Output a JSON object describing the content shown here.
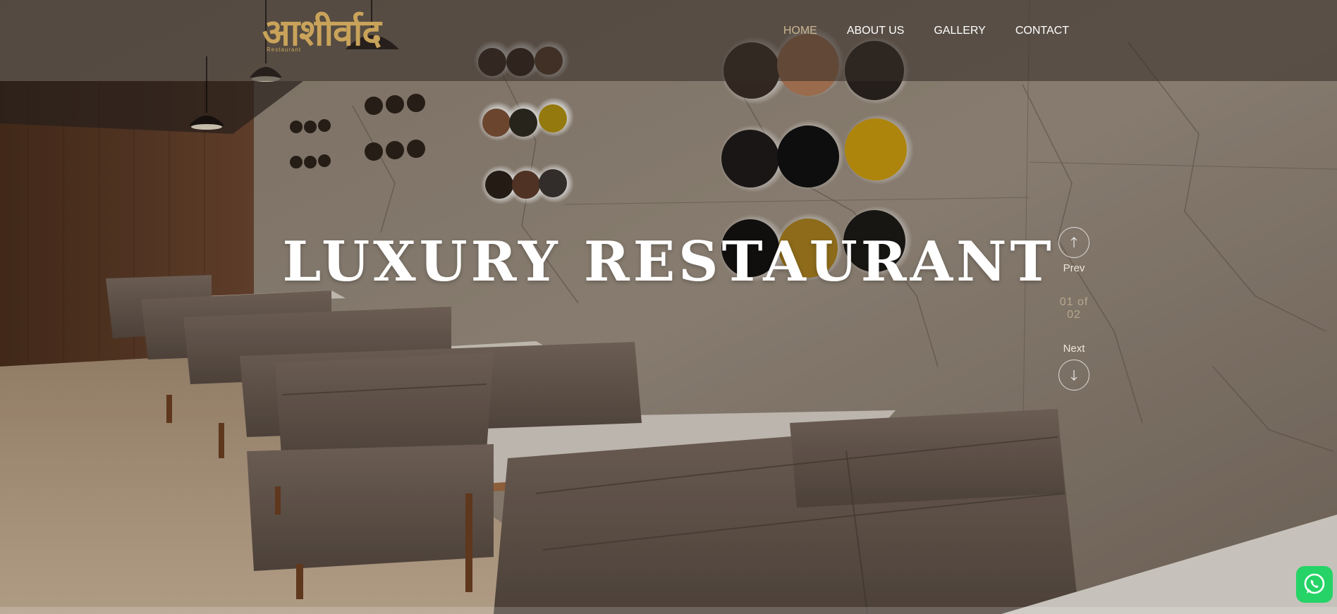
{
  "header": {
    "logo_text": "आशीर्वाद",
    "logo_subtext": "Restaurant"
  },
  "nav": {
    "items": [
      {
        "label": "HOME",
        "active": true
      },
      {
        "label": "ABOUT US",
        "active": false
      },
      {
        "label": "GALLERY",
        "active": false
      },
      {
        "label": "CONTACT",
        "active": false
      }
    ]
  },
  "hero": {
    "headline": "LUXURY RESTAURANT"
  },
  "slider": {
    "prev_label": "Prev",
    "next_label": "Next",
    "counter": "01 of 02",
    "prev_icon": "arrow-up-icon",
    "next_icon": "arrow-down-icon"
  },
  "floating": {
    "whatsapp_icon": "whatsapp-icon"
  },
  "colors": {
    "accent_gold": "#c9a35a",
    "nav_active": "#c9b58e",
    "whatsapp_green": "#25d366"
  }
}
